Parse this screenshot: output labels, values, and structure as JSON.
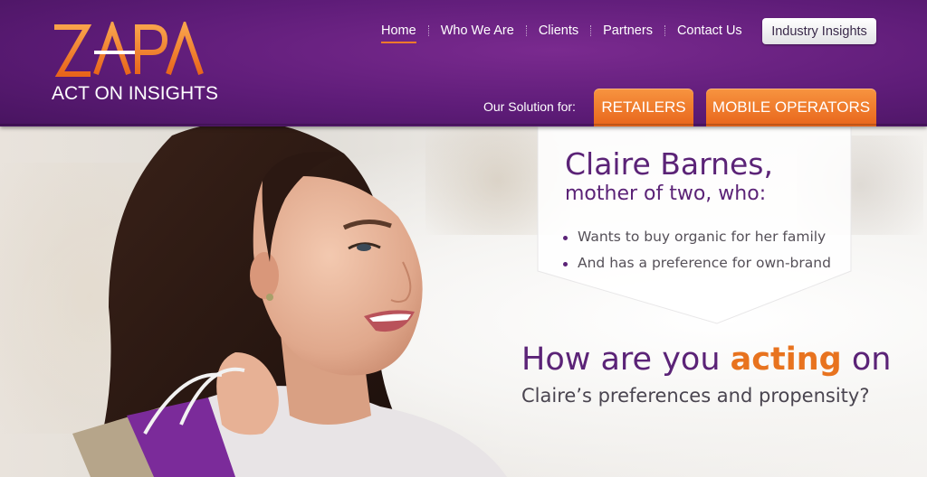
{
  "brand": {
    "logo_text": "ZAPA",
    "tagline": "ACT ON INSIGHTS",
    "colors": {
      "purple": "#5e1c78",
      "orange": "#f07a2a",
      "text_purple": "#5b2377"
    }
  },
  "nav": {
    "items": [
      {
        "label": "Home",
        "active": true
      },
      {
        "label": "Who We Are"
      },
      {
        "label": "Clients"
      },
      {
        "label": "Partners"
      },
      {
        "label": "Contact Us"
      }
    ],
    "cta_label": "Industry Insights"
  },
  "solutions": {
    "label": "Our Solution for:",
    "buttons": [
      "RETAILERS",
      "MOBILE OPERATORS"
    ]
  },
  "hero": {
    "callout": {
      "name": "Claire Barnes,",
      "subtitle": "mother of two, who:",
      "bullets": [
        "Wants to buy organic for her family",
        "And has a preference for own-brand"
      ]
    },
    "headline_pre": "How are you ",
    "headline_accent": "acting",
    "headline_post": " on",
    "subheadline": "Claire’s preferences and propensity?"
  }
}
